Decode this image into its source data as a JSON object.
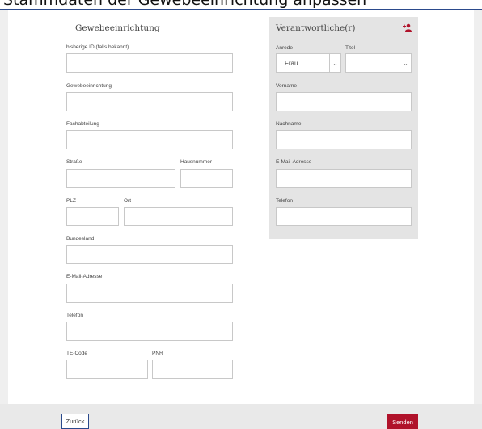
{
  "header": {
    "title": "Stammdaten der Gewebeeinrichtung anpassen"
  },
  "left": {
    "title": "Gewebeeinrichtung",
    "labels": {
      "prev_id": "bisherige ID (falls bekannt)",
      "facility": "Gewebeeinrichtung",
      "department": "Fachabteilung",
      "street": "Straße",
      "house_number": "Hausnummer",
      "zip": "PLZ",
      "city": "Ort",
      "state": "Bundesland",
      "email": "E-Mail-Adresse",
      "phone": "Telefon",
      "te_code": "TE-Code",
      "pnr": "PNR"
    },
    "values": {
      "prev_id": "",
      "facility": "",
      "department": "",
      "street": "",
      "house_number": "",
      "zip": "",
      "city": "",
      "state": "",
      "email": "",
      "phone": "",
      "te_code": "",
      "pnr": ""
    }
  },
  "right": {
    "title": "Verantwortliche(r)",
    "add_icon": "add-person-icon",
    "labels": {
      "salutation": "Anrede",
      "title": "Titel",
      "first_name": "Vorname",
      "last_name": "Nachname",
      "email": "E-Mail-Adresse",
      "phone": "Telefon"
    },
    "salutation_value": "Frau",
    "title_value": "",
    "values": {
      "first_name": "",
      "last_name": "",
      "email": "",
      "phone": ""
    }
  },
  "footer": {
    "back_label": "Zurück",
    "send_label": "Senden"
  },
  "colors": {
    "accent_red": "#b0122a",
    "border_blue": "#2b4a8c",
    "panel_grey": "#e4e4e4"
  }
}
